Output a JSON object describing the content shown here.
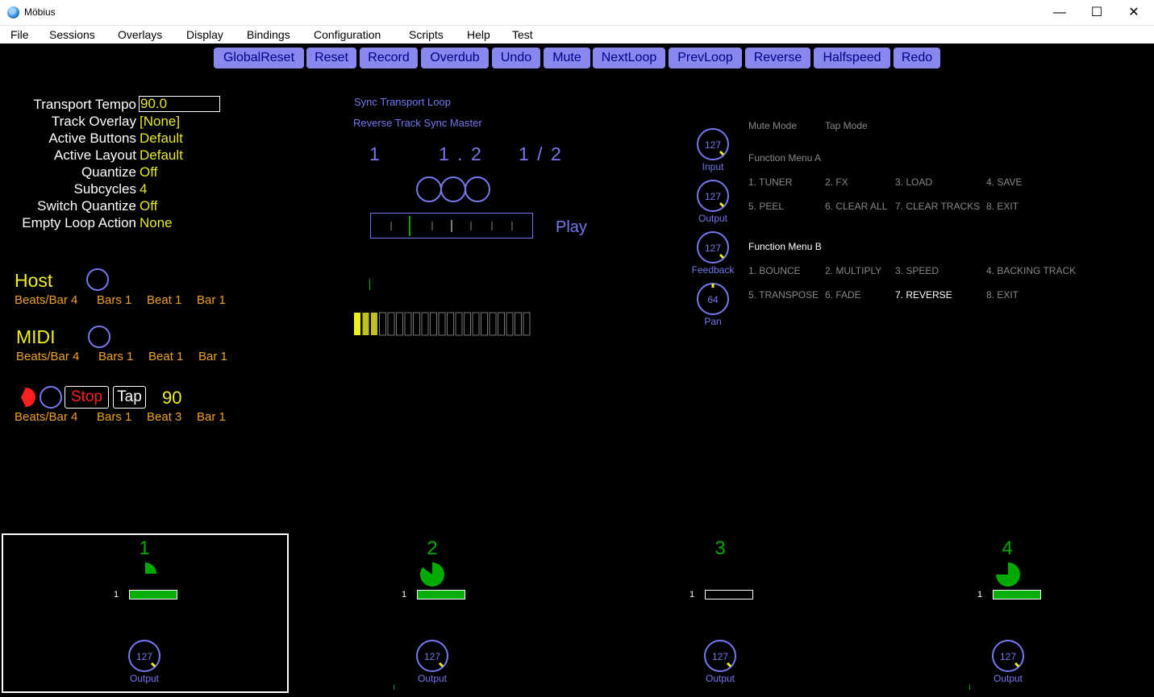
{
  "window": {
    "title": "Möbius",
    "minimize": "—",
    "maximize": "☐",
    "close": "✕"
  },
  "menu": [
    "File",
    "Sessions",
    "Overlays",
    "Display",
    "Bindings",
    "Configuration",
    "Scripts",
    "Help",
    "Test"
  ],
  "buttons": [
    "GlobalReset",
    "Reset",
    "Record",
    "Overdub",
    "Undo",
    "Mute",
    "NextLoop",
    "PrevLoop",
    "Reverse",
    "Halfspeed",
    "Redo"
  ],
  "parameters": [
    {
      "label": "Transport Tempo",
      "value": "90.0"
    },
    {
      "label": "Track Overlay",
      "value": "[None]"
    },
    {
      "label": "Active Buttons",
      "value": "Default"
    },
    {
      "label": "Active Layout",
      "value": "Default"
    },
    {
      "label": "Quantize",
      "value": "Off"
    },
    {
      "label": "Subcycles",
      "value": "4"
    },
    {
      "label": "Switch Quantize",
      "value": "Off"
    },
    {
      "label": "Empty Loop Action",
      "value": "None"
    }
  ],
  "sync": {
    "host": {
      "name": "Host",
      "beats_per_bar": "Beats/Bar 4",
      "bars": "Bars 1",
      "beat": "Beat 1",
      "bar": "Bar 1"
    },
    "midi": {
      "name": "MIDI",
      "beats_per_bar": "Beats/Bar 4",
      "bars": "Bars 1",
      "beat": "Beat 1",
      "bar": "Bar 1"
    },
    "transport": {
      "stop": "Stop",
      "tap": "Tap",
      "tempo": "90",
      "beats_per_bar": "Beats/Bar 4",
      "bars": "Bars 1",
      "beat": "Beat 3",
      "bar": "Bar 1"
    }
  },
  "status": {
    "sync_transport": "Sync Transport Loop",
    "reverse_sync": "Reverse Track Sync Master",
    "loop_number": "1",
    "cycle": "1 . 2",
    "ratio": "1 / 2",
    "mode": "Play",
    "meter_lit": 3,
    "meter_total": 21
  },
  "knobs": [
    {
      "label": "Input",
      "value": "127"
    },
    {
      "label": "Output",
      "value": "127"
    },
    {
      "label": "Feedback",
      "value": "127"
    },
    {
      "label": "Pan",
      "value": "64"
    }
  ],
  "modes": {
    "mute": "Mute Mode",
    "tap": "Tap Mode"
  },
  "function_menu_a": {
    "title": "Function Menu A",
    "items": [
      "1. TUNER",
      "2. FX",
      "3. LOAD",
      "4. SAVE",
      "5. PEEL",
      "6. CLEAR ALL",
      "7. CLEAR TRACKS",
      "8. EXIT"
    ]
  },
  "function_menu_b": {
    "title": "Function Menu B",
    "items": [
      "1. BOUNCE",
      "2. MULTIPLY",
      "3. SPEED",
      "4. BACKING TRACK",
      "5. TRANSPOSE",
      "6. FADE",
      "7. REVERSE",
      "8. EXIT"
    ]
  },
  "tracks": [
    {
      "number": "1",
      "loop": "1",
      "output_label": "Output",
      "output_value": "127",
      "progress": 0.25,
      "full": true,
      "selected": true
    },
    {
      "number": "2",
      "loop": "1",
      "output_label": "Output",
      "output_value": "127",
      "progress": 0.8,
      "full": true,
      "selected": false
    },
    {
      "number": "3",
      "loop": "1",
      "output_label": "Output",
      "output_value": "127",
      "progress": 0,
      "full": false,
      "selected": false
    },
    {
      "number": "4",
      "loop": "1",
      "output_label": "Output",
      "output_value": "127",
      "progress": 0.75,
      "full": true,
      "selected": false
    }
  ],
  "colors": {
    "accent": "#7777ee",
    "button_bg": "#8888ee",
    "value": "#e6e62a",
    "sync_field": "#f0a020",
    "track": "#00aa00",
    "stop": "#ff2020"
  },
  "icons": {
    "app": "mobius-app-icon"
  }
}
